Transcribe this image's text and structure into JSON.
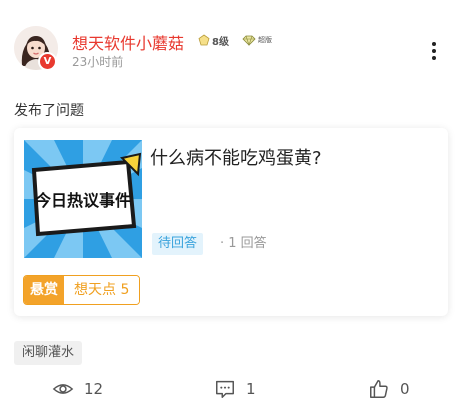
{
  "post": {
    "author": {
      "name": "想天软件小蘑菇",
      "level": "8级",
      "vip_label": "超版",
      "verified_mark": "V"
    },
    "time": "23小时前",
    "action": "发布了问题"
  },
  "question": {
    "thumbnail_text": "今日热议事件",
    "title": "什么病不能吃鸡蛋黄?",
    "status": "待回答",
    "answers": "· 1 回答",
    "bounty_tag": "悬赏",
    "bounty_value": "想天点 5"
  },
  "topic_tag": "闲聊灌水",
  "stats": {
    "views": "12",
    "comments": "1",
    "likes": "0"
  },
  "icons": [
    "more-vertical-icon",
    "level-icon",
    "vip-diamond-icon",
    "eye-icon",
    "comment-icon",
    "thumbs-up-icon"
  ],
  "colors": {
    "username": "#e8392f",
    "status_bg": "#e3f3fc",
    "status_text": "#3aa3dc",
    "bounty": "#f3a32a",
    "thumbnail_bg": "#2f9fe3"
  }
}
